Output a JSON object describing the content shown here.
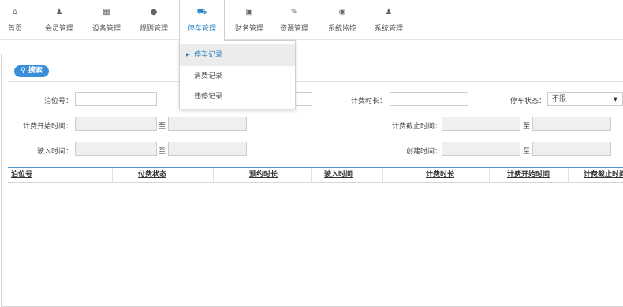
{
  "nav": [
    {
      "label": "首页",
      "icon": "home-icon",
      "glyph": "⌂"
    },
    {
      "label": "会员管理",
      "icon": "members-icon",
      "glyph": "♟"
    },
    {
      "label": "设备管理",
      "icon": "device-icon",
      "glyph": "▦"
    },
    {
      "label": "规则管理",
      "icon": "info-icon",
      "glyph": "●"
    },
    {
      "label": "停车管理",
      "icon": "car-icon",
      "glyph": "⛟"
    },
    {
      "label": "财务管理",
      "icon": "finance-icon",
      "glyph": "▣"
    },
    {
      "label": "资源管理",
      "icon": "edit-icon",
      "glyph": "✎"
    },
    {
      "label": "系统监控",
      "icon": "eye-icon",
      "glyph": "◉"
    },
    {
      "label": "系统管理",
      "icon": "system-icon",
      "glyph": "♟"
    }
  ],
  "dropdown": [
    "停车记录",
    "消费记录",
    "违停记录"
  ],
  "search": {
    "label": "搜索",
    "icon": "search-icon"
  },
  "filters": {
    "berth": "泊位号：",
    "duration": "计费时长：",
    "status": "停车状态：",
    "status_value": "不限",
    "start_time": "计费开始时间：",
    "end_time": "计费截止时间：",
    "enter_time": "驶入时间：",
    "create_time": "创建时间：",
    "to": "至"
  },
  "table": {
    "columns": [
      "泊位号",
      "付费状态",
      "预约时长",
      "驶入时间",
      "计费时长",
      "计费开始时间",
      "计费截止时间"
    ]
  },
  "colors": {
    "accent": "#2d84c6",
    "button": "#3a8fd8",
    "header_border": "#4a93d1"
  }
}
